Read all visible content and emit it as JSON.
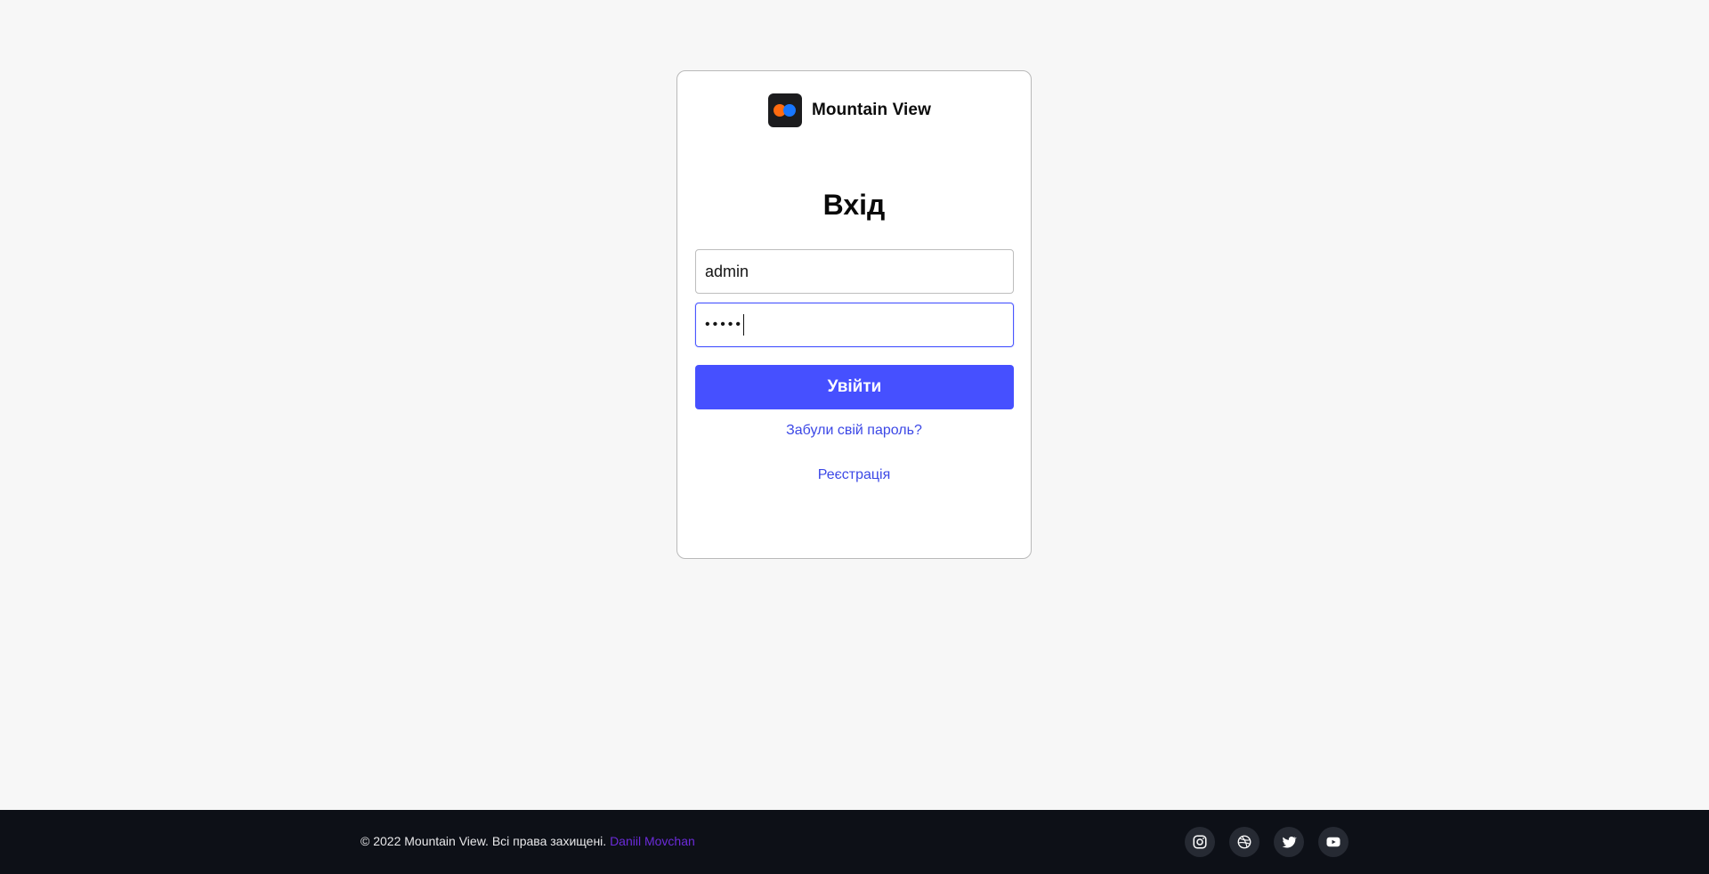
{
  "brand": {
    "name": "Mountain View",
    "logo_icon": "two-dots-logo-icon",
    "logo_colors": [
      "#ff6b10",
      "#1877ff"
    ]
  },
  "login": {
    "title": "Вхід",
    "username_value": "admin",
    "password_masked": "•••••",
    "submit_label": "Увійти",
    "forgot_label": "Забули свій пароль?",
    "register_label": "Реєстрація"
  },
  "colors": {
    "accent": "#4650ff",
    "link": "#3c48e6",
    "footer_bg": "#0d1017",
    "author_link": "#6b2bd9"
  },
  "footer": {
    "copyright": "© 2022 Mountain View. Всі права захищені.",
    "author": "Daniil Movchan",
    "socials": [
      {
        "icon": "instagram-icon"
      },
      {
        "icon": "dribbble-icon"
      },
      {
        "icon": "twitter-icon"
      },
      {
        "icon": "youtube-icon"
      }
    ]
  }
}
